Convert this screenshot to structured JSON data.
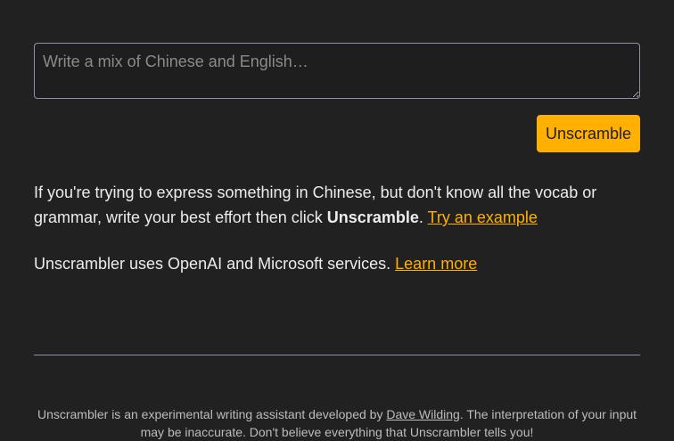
{
  "input": {
    "placeholder": "Write a mix of Chinese and English…"
  },
  "actions": {
    "unscramble_label": "Unscramble"
  },
  "intro": {
    "text_before": "If you're trying to express something in Chinese, but don't know all the vocab or grammar, write your best effort then click ",
    "bold": "Unscramble",
    "text_after": ". ",
    "example_link": "Try an example"
  },
  "services": {
    "text": "Unscrambler uses OpenAI and Microsoft services. ",
    "learn_more_link": "Learn more"
  },
  "footer": {
    "text_before": "Unscrambler is an experimental writing assistant developed by ",
    "author_link": "Dave Wilding",
    "text_after": ". The interpretation of your input may be inaccurate. Don't believe everything that Unscrambler tells you!"
  },
  "colors": {
    "background": "#222122",
    "accent": "#ffb000",
    "border": "#8f8fa6"
  }
}
